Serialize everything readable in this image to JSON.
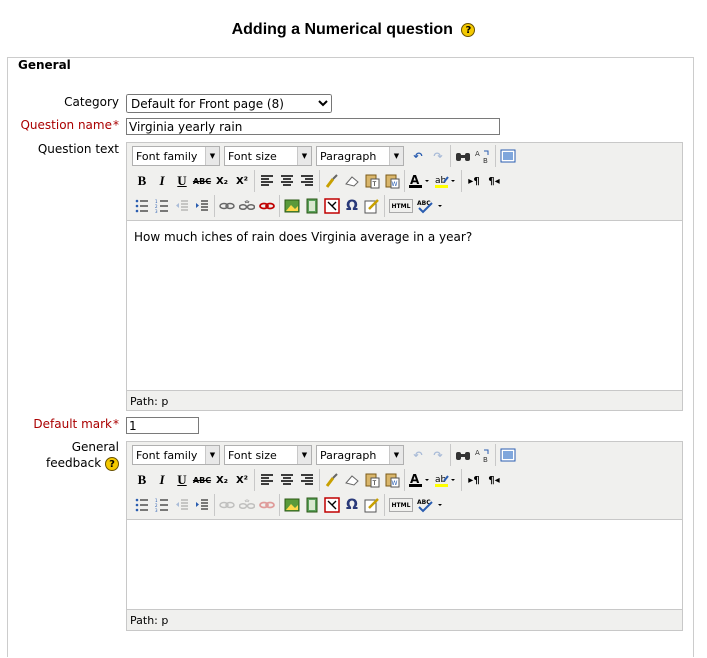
{
  "page_title": "Adding a Numerical question",
  "section_legend": "General",
  "fields": {
    "category": {
      "label": "Category",
      "value": "Default for Front page (8)"
    },
    "question_name": {
      "label": "Question name",
      "value": "Virginia yearly rain"
    },
    "question_text": {
      "label": "Question text",
      "content": "How much iches of rain does Virginia average in a year?",
      "path": "Path: p"
    },
    "default_mark": {
      "label": "Default mark",
      "value": "1"
    },
    "general_feedback": {
      "label_line1": "General",
      "label_line2": "feedback",
      "content": "",
      "path": "Path: p"
    }
  },
  "toolbar": {
    "font_family": "Font family",
    "font_size": "Font size",
    "format": "Paragraph",
    "html_label": "HTML",
    "abc_label": "ABC",
    "bold": "B",
    "italic": "I",
    "underline": "U",
    "strike": "ABC",
    "subscript": "X₂",
    "superscript": "X²",
    "omega": "Ω",
    "ltr": "▸¶",
    "rtl": "¶◂"
  },
  "help_symbol": "?",
  "required_marker": "*",
  "colors": {
    "required": "#aa0000",
    "editor_bg": "#f0f0ee",
    "help_yellow": "#f4c900"
  }
}
